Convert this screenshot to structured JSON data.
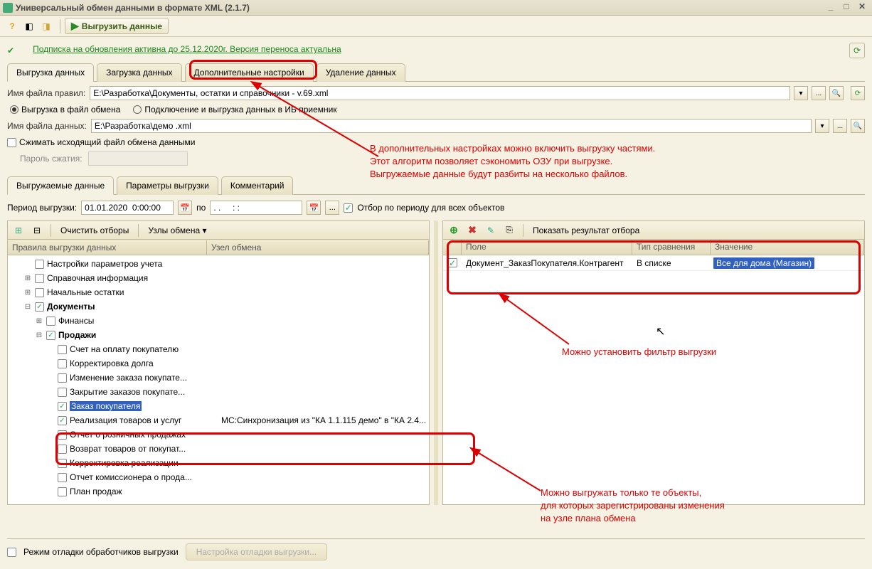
{
  "window": {
    "title": "Универсальный обмен данными в формате XML (2.1.7)"
  },
  "toolbar": {
    "run_label": "Выгрузить данные"
  },
  "subscription": {
    "text": "Подписка на обновления активна до 25.12.2020г. Версия переноса актуальна"
  },
  "tabs": {
    "export": "Выгрузка данных",
    "import": "Загрузка данных",
    "settings": "Дополнительные настройки",
    "delete": "Удаление данных"
  },
  "form": {
    "rules_label": "Имя файла правил:",
    "rules_value": "E:\\Разработка\\Документы, остатки и справочники - v.69.xml",
    "data_label": "Имя файла данных:",
    "data_value": "E:\\Разработка\\демо .xml",
    "radio_file": "Выгрузка в файл обмена",
    "radio_db": "Подключение и выгрузка данных в ИБ приемник",
    "compress": "Сжимать исходящий файл обмена данными",
    "pwd_label": "Пароль сжатия:"
  },
  "subtabs": {
    "data": "Выгружаемые данные",
    "params": "Параметры выгрузки",
    "comment": "Комментарий"
  },
  "period": {
    "label": "Период выгрузки:",
    "from": "01.01.2020  0:00:00",
    "to_label": "по",
    "to": ". .     : :",
    "all_check": "Отбор по периоду для всех объектов"
  },
  "left_pane": {
    "clear": "Очистить отборы",
    "nodes": "Узлы обмена ▾",
    "col_rules": "Правила выгрузки данных",
    "col_node": "Узел обмена",
    "tree": [
      {
        "lvl": 1,
        "exp": "",
        "chk": false,
        "bold": false,
        "label": "Настройки параметров учета"
      },
      {
        "lvl": 1,
        "exp": "⊞",
        "chk": false,
        "bold": false,
        "label": "Справочная информация"
      },
      {
        "lvl": 1,
        "exp": "⊞",
        "chk": false,
        "bold": false,
        "label": "Начальные остатки"
      },
      {
        "lvl": 1,
        "exp": "⊟",
        "chk": true,
        "bold": true,
        "label": "Документы"
      },
      {
        "lvl": 2,
        "exp": "⊞",
        "chk": false,
        "bold": false,
        "label": "Финансы"
      },
      {
        "lvl": 2,
        "exp": "⊟",
        "chk": true,
        "bold": true,
        "label": "Продажи"
      },
      {
        "lvl": 3,
        "exp": "",
        "chk": false,
        "bold": false,
        "label": "Счет на оплату покупателю"
      },
      {
        "lvl": 3,
        "exp": "",
        "chk": false,
        "bold": false,
        "label": "Корректировка долга"
      },
      {
        "lvl": 3,
        "exp": "",
        "chk": false,
        "bold": false,
        "label": "Изменение заказа покупате..."
      },
      {
        "lvl": 3,
        "exp": "",
        "chk": false,
        "bold": false,
        "label": "Закрытие заказов покупате..."
      },
      {
        "lvl": 3,
        "exp": "",
        "chk": true,
        "bold": false,
        "label": "Заказ покупателя",
        "sel": true
      },
      {
        "lvl": 3,
        "exp": "",
        "chk": true,
        "bold": false,
        "label": "Реализация товаров и услуг",
        "node": "МС:Синхронизация из \"КА 1.1.115 демо\" в \"КА 2.4..."
      },
      {
        "lvl": 3,
        "exp": "",
        "chk": false,
        "bold": false,
        "label": "Отчет о розничных продажах"
      },
      {
        "lvl": 3,
        "exp": "",
        "chk": false,
        "bold": false,
        "label": "Возврат товаров от покупат..."
      },
      {
        "lvl": 3,
        "exp": "",
        "chk": false,
        "bold": false,
        "label": "Корректировка реализации"
      },
      {
        "lvl": 3,
        "exp": "",
        "chk": false,
        "bold": false,
        "label": "Отчет комиссионера о прода..."
      },
      {
        "lvl": 3,
        "exp": "",
        "chk": false,
        "bold": false,
        "label": "План продаж"
      }
    ]
  },
  "right_pane": {
    "show_result": "Показать результат отбора",
    "col_field": "Поле",
    "col_cmp": "Тип сравнения",
    "col_val": "Значение",
    "row": {
      "checked": true,
      "field": "Документ_ЗаказПокупателя.Контрагент",
      "cmp": "В списке",
      "val": "Все для дома (Магазин)"
    }
  },
  "bottom": {
    "debug": "Режим отладки обработчиков выгрузки",
    "debug_btn": "Настройка отладки выгрузки..."
  },
  "annotations": {
    "a1": "В дополнительных настройках можно включить выгрузку частями.\nЭтот алгоритм позволяет сэкономить ОЗУ при выгрузке.\nВыгружаемые данные будут разбиты на несколько файлов.",
    "a2": "Можно установить фильтр выгрузки",
    "a3": "Можно выгружать только те объекты,\nдля которых зарегистрированы изменения\nна узле плана обмена"
  }
}
